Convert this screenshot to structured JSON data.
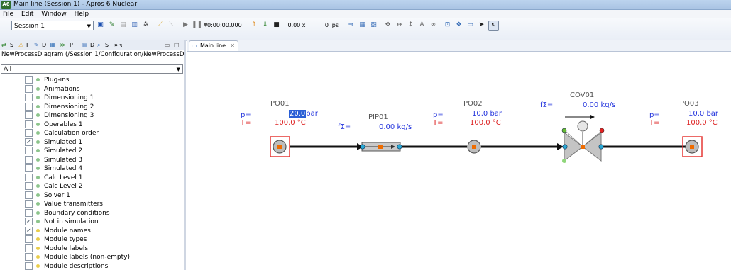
{
  "window": {
    "title": "Main line (Session 1) - Apros 6 Nuclear",
    "icon_text": "A6"
  },
  "menu": [
    "File",
    "Edit",
    "Window",
    "Help"
  ],
  "toolbar": {
    "session": "Session 1",
    "time": "0:00:00.000",
    "speed": "0.00 x",
    "ips": "0 ips"
  },
  "left_panel": {
    "tabs": [
      "S",
      "I",
      "D",
      "P",
      "D",
      "S",
      "3"
    ],
    "path": "NewProcessDiagram (/Session 1/Configuration/NewProcessDiagr",
    "filter": "All",
    "layers": [
      {
        "label": "Plug-ins",
        "checked": false,
        "dot": "green"
      },
      {
        "label": "Animations",
        "checked": false,
        "dot": "green"
      },
      {
        "label": "Dimensioning 1",
        "checked": false,
        "dot": "green"
      },
      {
        "label": "Dimensioning 2",
        "checked": false,
        "dot": "green"
      },
      {
        "label": "Dimensioning 3",
        "checked": false,
        "dot": "green"
      },
      {
        "label": "Operables 1",
        "checked": false,
        "dot": "green"
      },
      {
        "label": "Calculation order",
        "checked": false,
        "dot": "green"
      },
      {
        "label": "Simulated 1",
        "checked": true,
        "dot": "green"
      },
      {
        "label": "Simulated 2",
        "checked": false,
        "dot": "green"
      },
      {
        "label": "Simulated 3",
        "checked": false,
        "dot": "green"
      },
      {
        "label": "Simulated 4",
        "checked": false,
        "dot": "green"
      },
      {
        "label": "Calc Level 1",
        "checked": false,
        "dot": "green"
      },
      {
        "label": "Calc Level 2",
        "checked": false,
        "dot": "green"
      },
      {
        "label": "Solver 1",
        "checked": false,
        "dot": "green"
      },
      {
        "label": "Value transmitters",
        "checked": false,
        "dot": "green"
      },
      {
        "label": "Boundary conditions",
        "checked": false,
        "dot": "green"
      },
      {
        "label": "Not in simulation",
        "checked": true,
        "dot": "green"
      },
      {
        "label": "Module names",
        "checked": true,
        "dot": "yellow"
      },
      {
        "label": "Module types",
        "checked": false,
        "dot": "yellow"
      },
      {
        "label": "Module labels",
        "checked": false,
        "dot": "yellow"
      },
      {
        "label": "Module labels (non-empty)",
        "checked": false,
        "dot": "yellow"
      },
      {
        "label": "Module descriptions",
        "checked": false,
        "dot": "yellow"
      }
    ]
  },
  "editor": {
    "tab": "Main line",
    "diagram": {
      "po01": {
        "name": "PO01",
        "p_label": "p=",
        "p_value": "20.0",
        "p_unit": "bar",
        "t_label": "T=",
        "t_value": "100.0 °C"
      },
      "pip01": {
        "name": "PIP01",
        "f_label": "fΣ=",
        "f_value": "0.00 kg/s"
      },
      "po02": {
        "name": "PO02",
        "p_label": "p=",
        "p_value": "10.0 bar",
        "t_label": "T=",
        "t_value": "100.0 °C"
      },
      "cov01": {
        "name": "COV01",
        "f_label": "fΣ=",
        "f_value": "0.00 kg/s"
      },
      "po03": {
        "name": "PO03",
        "p_label": "p=",
        "p_value": "10.0 bar",
        "t_label": "T=",
        "t_value": "100.0 °C"
      }
    }
  },
  "colors": {
    "value_blue": "#2233dd",
    "temp_red": "#dd2222",
    "select_red": "#e53935",
    "pipe": "#111111"
  }
}
